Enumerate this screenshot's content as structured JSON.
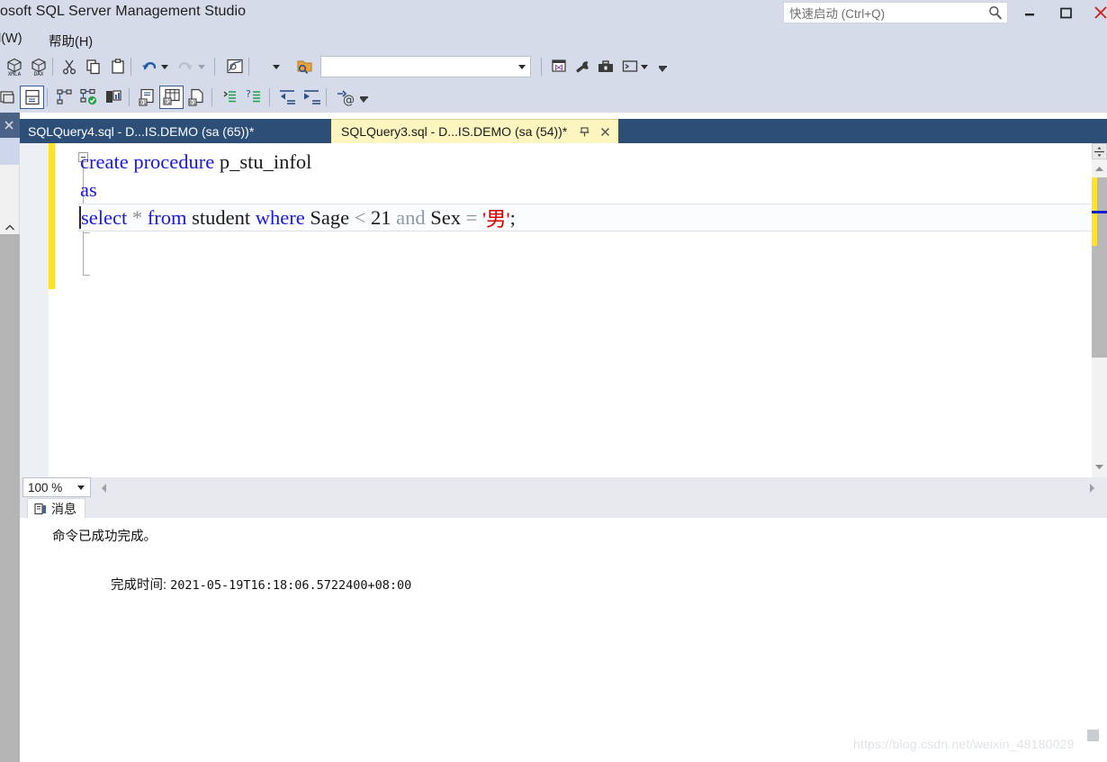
{
  "window": {
    "title": "osoft SQL Server Management Studio",
    "controls": {
      "minimize": "minimize-button",
      "maximize": "maximize-button",
      "close": "close-button"
    }
  },
  "quick_launch": {
    "placeholder": "快速启动 (Ctrl+Q)",
    "value": "",
    "icon": "search-icon"
  },
  "menubar": {
    "items": [
      {
        "label": "l(W)",
        "name": "menu-window"
      },
      {
        "label": "帮助(H)",
        "name": "menu-help"
      }
    ]
  },
  "toolbar_primary": {
    "items": [
      {
        "name": "xmla-query-button",
        "icon": "cube-xmla-icon"
      },
      {
        "name": "dax-query-button",
        "icon": "cube-dax-icon"
      },
      {
        "name": "cut-button",
        "icon": "scissors-icon"
      },
      {
        "name": "copy-button",
        "icon": "copy-icon"
      },
      {
        "name": "paste-button",
        "icon": "paste-icon"
      },
      {
        "name": "undo-button",
        "icon": "undo-arrow-icon"
      },
      {
        "name": "undo-dropdown",
        "icon": "chevron-down-icon"
      },
      {
        "name": "redo-button",
        "icon": "redo-arrow-icon"
      },
      {
        "name": "redo-dropdown",
        "icon": "chevron-down-icon"
      },
      {
        "name": "execution-plan-button",
        "icon": "chart-window-icon"
      },
      {
        "name": "database-dropdown",
        "icon": "chevron-down-icon"
      },
      {
        "name": "find-in-files-button",
        "icon": "folder-search-icon"
      },
      {
        "name": "sql-editor-window-button",
        "icon": "sql-window-icon"
      },
      {
        "name": "properties-button",
        "icon": "wrench-icon"
      },
      {
        "name": "toolbox-button",
        "icon": "toolbox-icon"
      },
      {
        "name": "command-prompt-button",
        "icon": "console-icon"
      },
      {
        "name": "command-prompt-dropdown",
        "icon": "chevron-down-icon"
      },
      {
        "name": "toolbar-overflow-button",
        "icon": "overflow-chevron-icon"
      }
    ],
    "database_combo": {
      "value": "",
      "placeholder": ""
    }
  },
  "toolbar_secondary": {
    "items": [
      {
        "name": "results-to-window-button",
        "icon": "window-panes-icon"
      },
      {
        "name": "results-to-grid-button",
        "icon": "split-pane-icon",
        "selected": true
      },
      {
        "name": "parse-button",
        "icon": "parse-tree-icon"
      },
      {
        "name": "check-syntax-button",
        "icon": "parse-check-icon"
      },
      {
        "name": "display-estimated-plan-button",
        "icon": "server-plan-icon"
      },
      {
        "name": "results-to-text-button",
        "icon": "results-text-icon"
      },
      {
        "name": "results-to-grid-toggle",
        "icon": "results-grid-icon",
        "selected": true
      },
      {
        "name": "results-to-file-button",
        "icon": "results-file-icon"
      },
      {
        "name": "comment-button",
        "icon": "comment-lines-icon"
      },
      {
        "name": "uncomment-button",
        "icon": "uncomment-lines-icon"
      },
      {
        "name": "decrease-indent-button",
        "icon": "outdent-icon"
      },
      {
        "name": "increase-indent-button",
        "icon": "indent-icon"
      },
      {
        "name": "specify-values-button",
        "icon": "at-arrow-icon"
      },
      {
        "name": "toolbar-overflow-button-2",
        "icon": "overflow-chevron-icon"
      }
    ]
  },
  "left_panel": {
    "close_icon": "close-icon",
    "scroll_up_icon": "chevron-up-icon"
  },
  "tabs": [
    {
      "label": "SQLQuery4.sql - D...IS.DEMO (sa (65))*",
      "name": "tab-sqlquery4",
      "active": false
    },
    {
      "label": "SQLQuery3.sql - D...IS.DEMO (sa (54))*",
      "name": "tab-sqlquery3",
      "active": true,
      "pin_icon": "pin-icon",
      "close_icon": "close-icon"
    }
  ],
  "editor": {
    "lines": [
      {
        "tokens": [
          {
            "text": "create procedure ",
            "cls": "kw"
          },
          {
            "text": "p_stu_infol",
            "cls": "ident"
          }
        ]
      },
      {
        "tokens": [
          {
            "text": "as",
            "cls": "kw"
          }
        ]
      },
      {
        "tokens": [
          {
            "text": "select ",
            "cls": "kw"
          },
          {
            "text": "* ",
            "cls": "op"
          },
          {
            "text": "from ",
            "cls": "kw"
          },
          {
            "text": "student ",
            "cls": "ident"
          },
          {
            "text": "where ",
            "cls": "kw"
          },
          {
            "text": "Sage ",
            "cls": "ident"
          },
          {
            "text": "< ",
            "cls": "op"
          },
          {
            "text": "21 ",
            "cls": "num"
          },
          {
            "text": "and ",
            "cls": "kwg"
          },
          {
            "text": "Sex ",
            "cls": "ident"
          },
          {
            "text": "= ",
            "cls": "op"
          },
          {
            "text": "'男'",
            "cls": "str"
          },
          {
            "text": ";",
            "cls": "ident"
          }
        ]
      }
    ],
    "plain_text": "create procedure p_stu_infol\nas\nselect * from student where Sage < 21 and Sex = '男';",
    "fold_icon": "collapse-minus-icon",
    "split_icon": "split-view-icon",
    "scroll_up_icon": "scroll-up-arrow-icon",
    "scroll_down_icon": "scroll-down-arrow-icon"
  },
  "zoom_bar": {
    "value": "100 %",
    "dropdown_icon": "chevron-down-icon",
    "scroll_left_icon": "scroll-left-arrow-icon",
    "scroll_right_icon": "scroll-right-arrow-icon"
  },
  "results_pane": {
    "tab": {
      "label": "消息",
      "icon": "messages-icon",
      "name": "tab-messages"
    },
    "messages": [
      {
        "text": "命令已成功完成。"
      },
      {
        "label": "完成时间: ",
        "text": "2021-05-19T16:18:06.5722400+08:00"
      }
    ]
  },
  "watermark": {
    "text": "https://blog.csdn.net/weixin_48180029"
  },
  "colors": {
    "chrome": "#d6dbe9",
    "tab_active_bg": "#fdf5c0",
    "tab_strip_bg": "#2d4e77",
    "keyword": "#1919d8",
    "string": "#d40000",
    "operator": "#8b8b8b",
    "change_bar": "#ffe32b"
  }
}
